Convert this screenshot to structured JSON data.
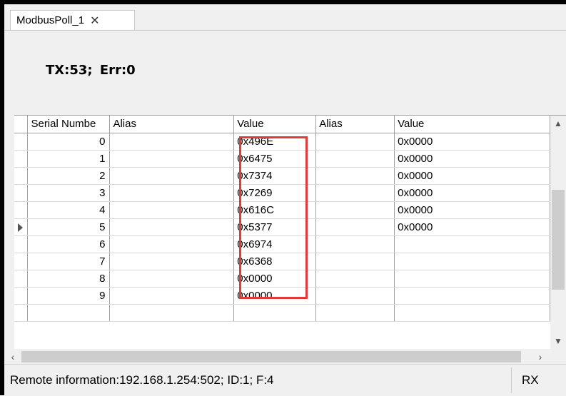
{
  "tab": {
    "title": "ModbusPoll_1",
    "close_icon": "close-icon"
  },
  "info": {
    "tx": "TX:53;",
    "err": "Err:0"
  },
  "grid": {
    "headers": [
      "Serial Numbe",
      "Alias",
      "Value",
      "Alias",
      "Value"
    ],
    "rows": [
      {
        "serial": "0",
        "alias1": "",
        "value1": "0x496E",
        "alias2": "",
        "value2": "0x0000"
      },
      {
        "serial": "1",
        "alias1": "",
        "value1": "0x6475",
        "alias2": "",
        "value2": "0x0000"
      },
      {
        "serial": "2",
        "alias1": "",
        "value1": "0x7374",
        "alias2": "",
        "value2": "0x0000"
      },
      {
        "serial": "3",
        "alias1": "",
        "value1": "0x7269",
        "alias2": "",
        "value2": "0x0000"
      },
      {
        "serial": "4",
        "alias1": "",
        "value1": "0x616C",
        "alias2": "",
        "value2": "0x0000"
      },
      {
        "serial": "5",
        "alias1": "",
        "value1": "0x5377",
        "alias2": "",
        "value2": "0x0000"
      },
      {
        "serial": "6",
        "alias1": "",
        "value1": "0x6974",
        "alias2": "",
        "value2": ""
      },
      {
        "serial": "7",
        "alias1": "",
        "value1": "0x6368",
        "alias2": "",
        "value2": ""
      },
      {
        "serial": "8",
        "alias1": "",
        "value1": "0x0000",
        "alias2": "",
        "value2": ""
      },
      {
        "serial": "9",
        "alias1": "",
        "value1": "0x0000",
        "alias2": "",
        "value2": ""
      }
    ],
    "selected_row": 5,
    "highlight_color": "#e03a3a"
  },
  "status": {
    "remote_info": "Remote information:192.168.1.254:502;  ID:1; F:4",
    "rx": "RX"
  }
}
